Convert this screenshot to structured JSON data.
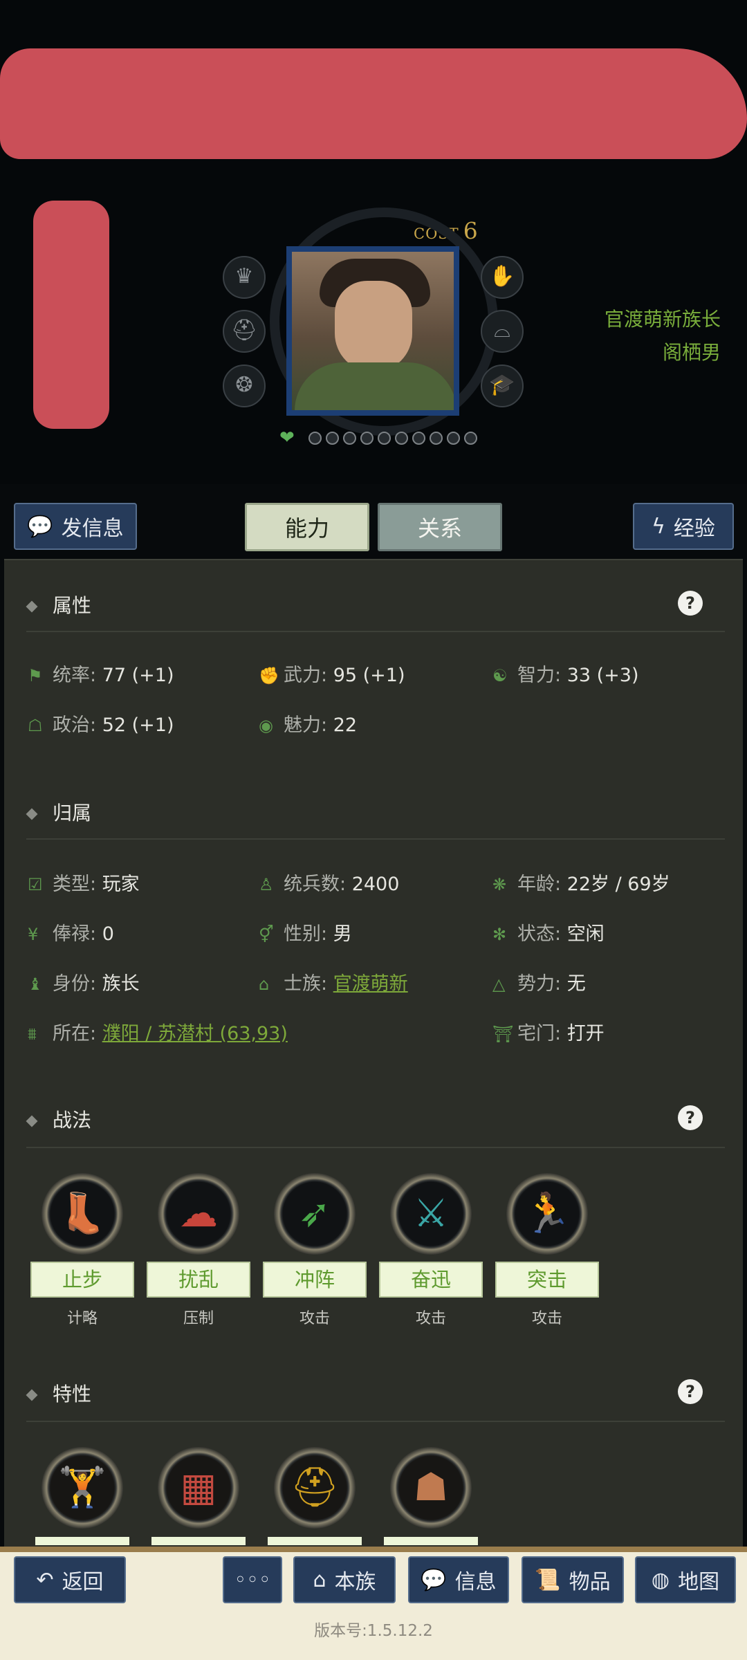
{
  "header": {
    "cost_label": "COST",
    "cost_value": "6",
    "clan_title": "官渡萌新族长",
    "name": "阁栖男",
    "left_icons": [
      "crown-icon",
      "helmet-icon",
      "lion-icon"
    ],
    "right_icons": [
      "hand-coin-icon",
      "hat-icon",
      "graduation-cap-icon"
    ],
    "star_dots": 10
  },
  "tabs": {
    "message": "发信息",
    "ability": "能力",
    "relation": "关系",
    "experience": "经验"
  },
  "attributes": {
    "title": "属性",
    "help": "?",
    "items": [
      {
        "key": "统率",
        "value": "77 (+1)"
      },
      {
        "key": "武力",
        "value": "95 (+1)"
      },
      {
        "key": "智力",
        "value": "33 (+3)"
      },
      {
        "key": "政治",
        "value": "52 (+1)"
      },
      {
        "key": "魅力",
        "value": "22"
      }
    ]
  },
  "belonging": {
    "title": "归属",
    "type_k": "类型",
    "type_v": "玩家",
    "troops_k": "统兵数",
    "troops_v": "2400",
    "age_k": "年龄",
    "age_v": "22岁 / 69岁",
    "salary_k": "俸禄",
    "salary_v": "0",
    "gender_k": "性别",
    "gender_v": "男",
    "status_k": "状态",
    "status_v": "空闲",
    "identity_k": "身份",
    "identity_v": "族长",
    "clan_k": "士族",
    "clan_v": "官渡萌新",
    "force_k": "势力",
    "force_v": "无",
    "location_k": "所在",
    "location_v": "濮阳 / 苏潜村 (63,93)",
    "gate_k": "宅门",
    "gate_v": "打开"
  },
  "tactics": {
    "title": "战法",
    "help": "?",
    "items": [
      {
        "name": "止步",
        "type": "计略",
        "icon": "boot-icon",
        "color": "#9b3fb8"
      },
      {
        "name": "扰乱",
        "type": "压制",
        "icon": "cloud-icon",
        "color": "#c8453b"
      },
      {
        "name": "冲阵",
        "type": "攻击",
        "icon": "arrows-icon",
        "color": "#4aa84a"
      },
      {
        "name": "奋迅",
        "type": "攻击",
        "icon": "crossed-swords-icon",
        "color": "#3aa6a6"
      },
      {
        "name": "突击",
        "type": "攻击",
        "icon": "charge-icon",
        "color": "#3aa6b6"
      }
    ]
  },
  "traits": {
    "title": "特性",
    "help": "?",
    "items": [
      {
        "icon": "strongman-icon",
        "color": "#c08050"
      },
      {
        "icon": "tree-bark-icon",
        "color": "#c44a40"
      },
      {
        "icon": "horned-helmet-icon",
        "color": "#d0a020"
      },
      {
        "icon": "ghost-icon",
        "color": "#c07a50"
      }
    ]
  },
  "bottom_nav": {
    "back": "返回",
    "more": "◦◦◦",
    "clan": "本族",
    "info": "信息",
    "items": "物品",
    "map": "地图"
  },
  "version": "版本号:1.5.12.2"
}
